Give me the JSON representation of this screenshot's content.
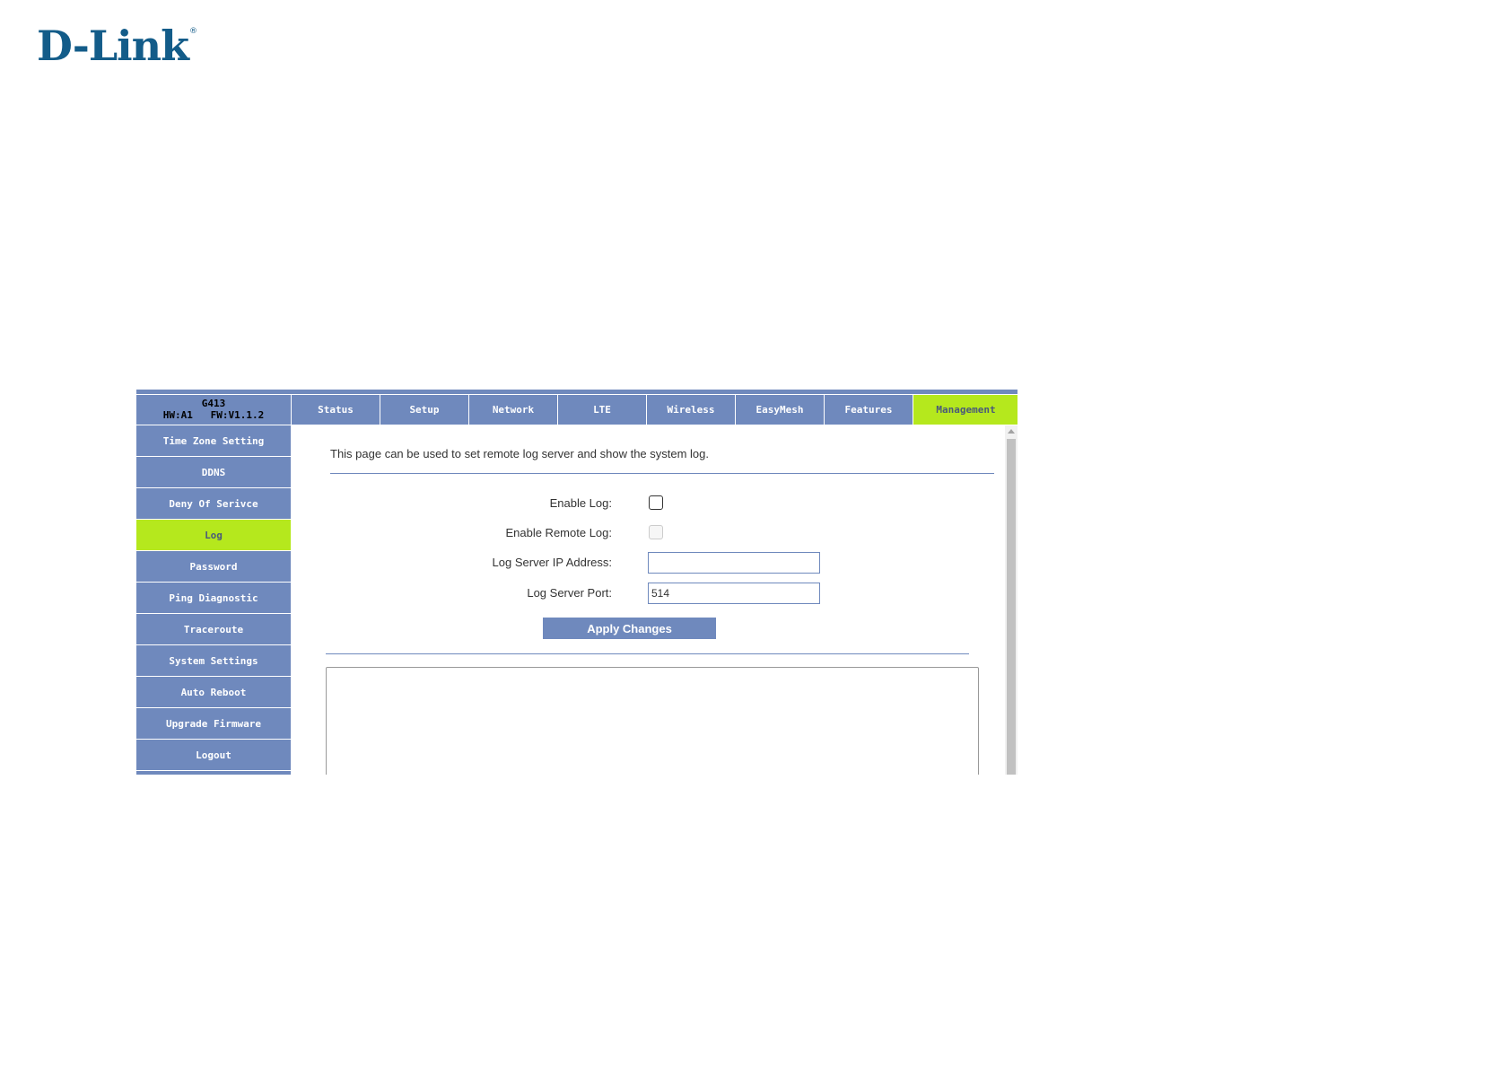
{
  "brand": {
    "logo_text": "D-Link",
    "registered_mark": "®"
  },
  "device": {
    "model": "G413",
    "versions": "HW:A1   FW:V1.1.2"
  },
  "tabs": [
    {
      "label": "Status"
    },
    {
      "label": "Setup"
    },
    {
      "label": "Network"
    },
    {
      "label": "LTE"
    },
    {
      "label": "Wireless"
    },
    {
      "label": "EasyMesh"
    },
    {
      "label": "Features"
    },
    {
      "label": "Management",
      "active": true
    }
  ],
  "sidebar": {
    "items": [
      {
        "label": "Time Zone Setting"
      },
      {
        "label": "DDNS"
      },
      {
        "label": "Deny Of Serivce"
      },
      {
        "label": "Log",
        "active": true
      },
      {
        "label": "Password"
      },
      {
        "label": "Ping Diagnostic"
      },
      {
        "label": "Traceroute"
      },
      {
        "label": "System Settings"
      },
      {
        "label": "Auto Reboot"
      },
      {
        "label": "Upgrade Firmware"
      },
      {
        "label": "Logout"
      }
    ]
  },
  "content": {
    "description": "This page can be used to set remote log server and show the system log.",
    "enable_log_label": "Enable Log:",
    "enable_log_checked": false,
    "enable_remote_log_label": "Enable Remote Log:",
    "enable_remote_log_checked": false,
    "log_server_ip_label": "Log Server IP Address:",
    "log_server_ip_value": "",
    "log_server_port_label": "Log Server Port:",
    "log_server_port_value": "514",
    "apply_label": "Apply Changes",
    "system_log_text": ""
  },
  "colors": {
    "nav_blue": "#6f89bd",
    "active_green": "#b5e81d",
    "brand_blue": "#135c89"
  }
}
